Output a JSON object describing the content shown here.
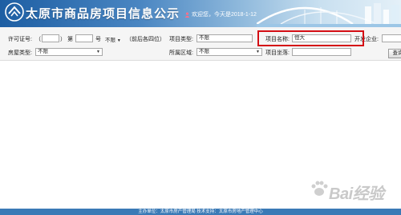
{
  "header": {
    "title": "太原市商品房项目信息公示",
    "welcome": "欢迎您，今天是2018-1-12",
    "colors": {
      "banner_dark": "#1d5ea3",
      "banner_light": "#e4f0f8"
    }
  },
  "search": {
    "permit": {
      "label": "许可证号:",
      "open_paren": "（",
      "close_paren": "）",
      "number_label": "第",
      "suffix_label": "号",
      "digits_select": "不限",
      "hint": "（前后各四位）"
    },
    "project_type": {
      "label": "项目类型:",
      "value": "不限"
    },
    "project_name": {
      "label": "项目名称:",
      "value": "恒大"
    },
    "developer": {
      "label": "开发企业:",
      "value": ""
    },
    "house_type": {
      "label": "房屋类型:",
      "value": "不限"
    },
    "district": {
      "label": "所属区域:",
      "value": "不限"
    },
    "location": {
      "label": "项目坐落:",
      "value": ""
    },
    "query_button": "查询",
    "highlight_color": "#d40d14"
  },
  "footer": {
    "text": "主办单位：太原市房产管理局    技术支持：太原市房地产管理中心"
  },
  "watermark": {
    "text": "Bai经验"
  }
}
